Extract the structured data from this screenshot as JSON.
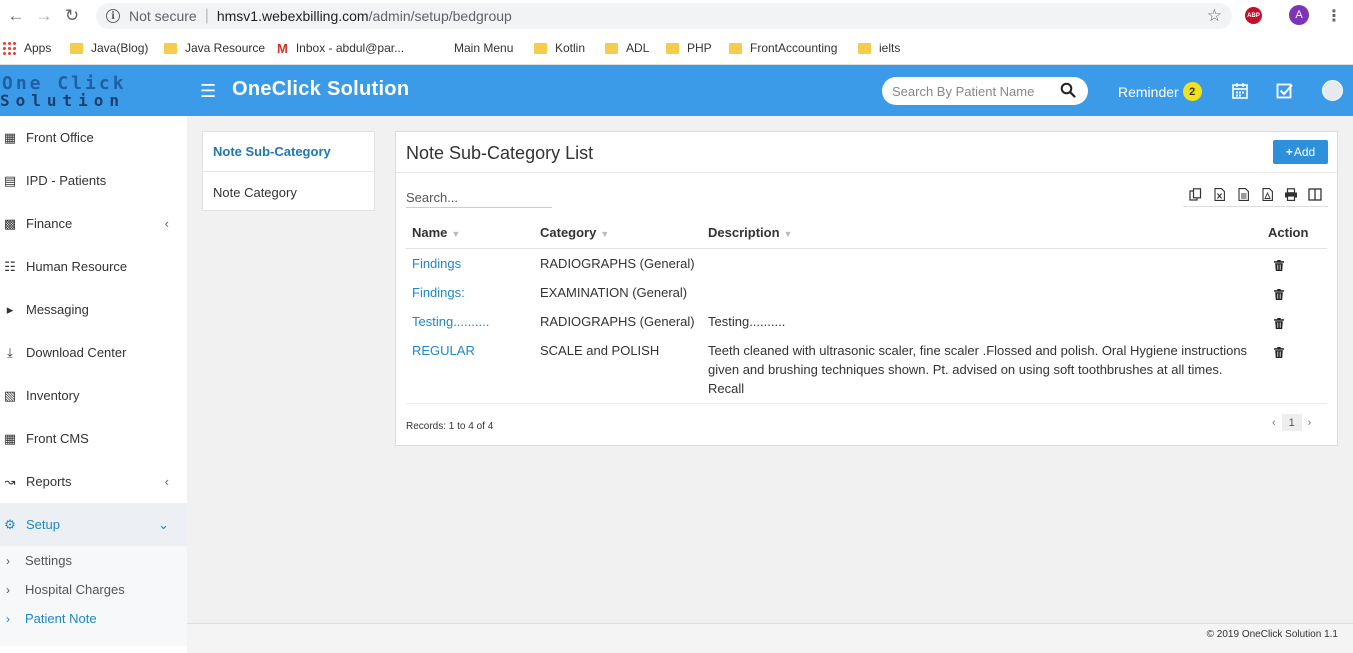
{
  "browser": {
    "not_secure": "Not secure",
    "url_host": "hmsv1.webexbilling.com",
    "url_path": "/admin/setup/bedgroup",
    "profile_initial": "A",
    "abp": "ABP"
  },
  "bookmarks": {
    "apps": "Apps",
    "items": [
      "Java(Blog)",
      "Java Resource",
      "Inbox - abdul@par...",
      "Main Menu",
      "Kotlin",
      "ADL",
      "PHP",
      "FrontAccounting",
      "ielts"
    ]
  },
  "header": {
    "logo_line1": "One Click",
    "logo_line2": "Solution",
    "title": "OneClick Solution",
    "search_placeholder": "Search By Patient Name",
    "reminder_label": "Reminder",
    "reminder_count": "2",
    "brand_color": "#3c9be8"
  },
  "sidebar": {
    "items": [
      {
        "label": "Front Office",
        "icon": "building-icon"
      },
      {
        "label": "IPD - Patients",
        "icon": "bed-icon"
      },
      {
        "label": "Finance",
        "icon": "money-icon"
      },
      {
        "label": "Human Resource",
        "icon": "sitemap-icon"
      },
      {
        "label": "Messaging",
        "icon": "bullhorn-icon"
      },
      {
        "label": "Download Center",
        "icon": "download-icon"
      },
      {
        "label": "Inventory",
        "icon": "inventory-icon"
      },
      {
        "label": "Front CMS",
        "icon": "cms-icon"
      },
      {
        "label": "Reports",
        "icon": "line-chart-icon"
      },
      {
        "label": "Setup",
        "icon": "gears-icon"
      }
    ],
    "setup_sub": [
      "Settings",
      "Hospital Charges",
      "Patient Note"
    ]
  },
  "subnav": {
    "items": [
      "Note Sub-Category",
      "Note Category"
    ]
  },
  "panel": {
    "title": "Note Sub-Category List",
    "add_label": "Add",
    "search_placeholder": "Search...",
    "columns": [
      "Name",
      "Category",
      "Description",
      "Action"
    ],
    "rows": [
      {
        "name": "Findings",
        "category": "RADIOGRAPHS (General)",
        "description": ""
      },
      {
        "name": "Findings:",
        "category": "EXAMINATION (General)",
        "description": ""
      },
      {
        "name": "Testing..........",
        "category": "RADIOGRAPHS (General)",
        "description": "Testing.........."
      },
      {
        "name": "REGULAR",
        "category": "SCALE and POLISH",
        "description": "Teeth cleaned with ultrasonic scaler, fine scaler .Flossed and polish. Oral Hygiene instructions given and brushing techniques shown. Pt. advised on using soft toothbrushes at all times. Recall"
      }
    ],
    "records": "Records: 1 to 4 of 4",
    "page": "1",
    "prev": "‹",
    "next": "›"
  },
  "footer": {
    "text": "© 2019 OneClick Solution 1.1"
  }
}
